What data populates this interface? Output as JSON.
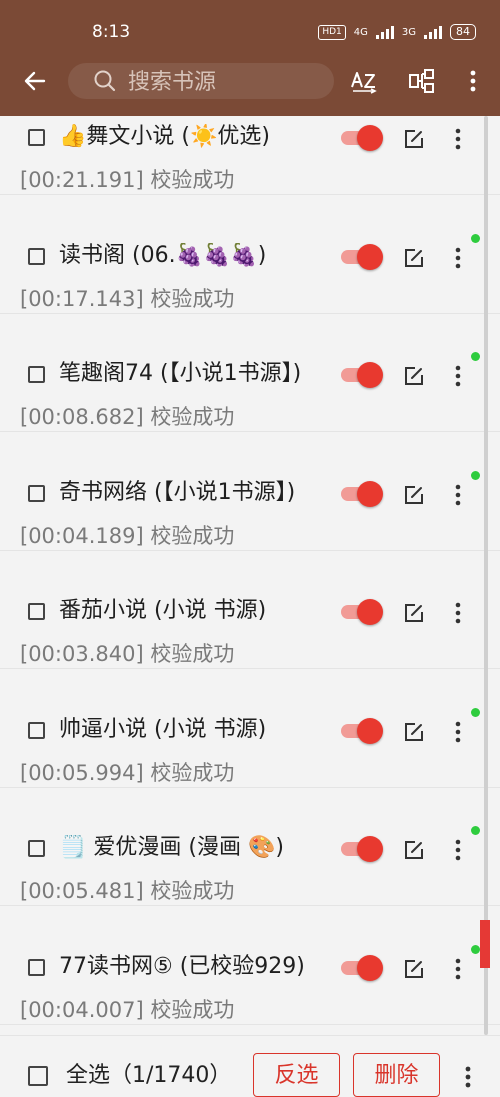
{
  "status_bar": {
    "time": "8:13",
    "hd_label": "HD1",
    "network_label": "4G",
    "network2_label": "3G",
    "battery": "84"
  },
  "header": {
    "search_placeholder": "搜索书源",
    "back_icon": "arrow-left-icon",
    "sort_icon": "sort-az-icon",
    "group_icon": "group-icon",
    "menu_icon": "more-vert-icon",
    "background_color": "#7b4a36"
  },
  "sources": [
    {
      "title": "👍舞文小说 (☀️优选)",
      "status": "[00:21.191] 校验成功",
      "enabled": true,
      "has_update": false
    },
    {
      "title": "读书阁 (06.🍇🍇🍇)",
      "status": "[00:17.143] 校验成功",
      "enabled": true,
      "has_update": true
    },
    {
      "title": "笔趣阁74 (【小说1书源】)",
      "status": "[00:08.682] 校验成功",
      "enabled": true,
      "has_update": true
    },
    {
      "title": "奇书网络 (【小说1书源】)",
      "status": "[00:04.189] 校验成功",
      "enabled": true,
      "has_update": true
    },
    {
      "title": "番茄小说 (小说 书源)",
      "status": "[00:03.840] 校验成功",
      "enabled": true,
      "has_update": false
    },
    {
      "title": "帅逼小说 (小说 书源)",
      "status": "[00:05.994] 校验成功",
      "enabled": true,
      "has_update": true
    },
    {
      "title": "🗒️ 爱优漫画 (漫画 🎨)",
      "status": "[00:05.481] 校验成功",
      "enabled": true,
      "has_update": true
    },
    {
      "title": "77读书网⑤ (已校验929)",
      "status": "[00:04.007] 校验成功",
      "enabled": true,
      "has_update": true
    }
  ],
  "footer": {
    "select_all_label": "全选（1/1740）",
    "invert_label": "反选",
    "delete_label": "删除"
  },
  "colors": {
    "accent": "#e8392f",
    "accent_light": "#f19b96",
    "update_dot": "#2ecc3e"
  }
}
